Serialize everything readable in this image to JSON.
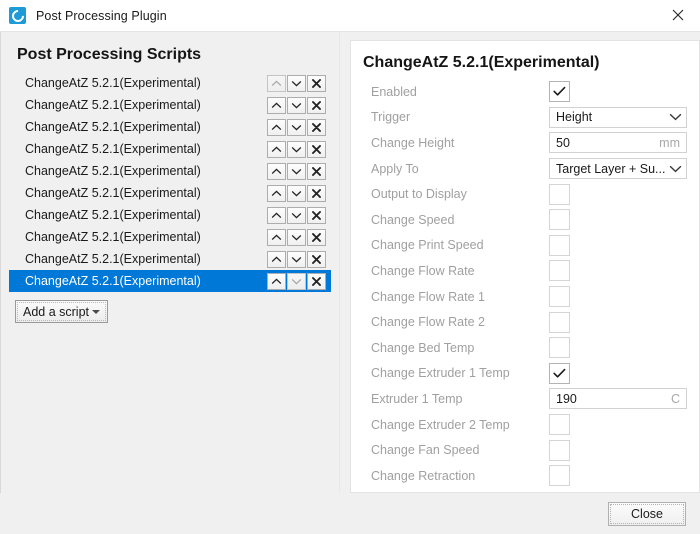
{
  "window": {
    "title": "Post Processing Plugin",
    "app_icon": "cura-logo-icon",
    "close_icon": "close-icon"
  },
  "left_panel": {
    "heading": "Post Processing Scripts",
    "scripts": [
      {
        "label": "ChangeAtZ 5.2.1(Experimental)",
        "selected": false,
        "up_enabled": false,
        "down_enabled": true
      },
      {
        "label": "ChangeAtZ 5.2.1(Experimental)",
        "selected": false,
        "up_enabled": true,
        "down_enabled": true
      },
      {
        "label": "ChangeAtZ 5.2.1(Experimental)",
        "selected": false,
        "up_enabled": true,
        "down_enabled": true
      },
      {
        "label": "ChangeAtZ 5.2.1(Experimental)",
        "selected": false,
        "up_enabled": true,
        "down_enabled": true
      },
      {
        "label": "ChangeAtZ 5.2.1(Experimental)",
        "selected": false,
        "up_enabled": true,
        "down_enabled": true
      },
      {
        "label": "ChangeAtZ 5.2.1(Experimental)",
        "selected": false,
        "up_enabled": true,
        "down_enabled": true
      },
      {
        "label": "ChangeAtZ 5.2.1(Experimental)",
        "selected": false,
        "up_enabled": true,
        "down_enabled": true
      },
      {
        "label": "ChangeAtZ 5.2.1(Experimental)",
        "selected": false,
        "up_enabled": true,
        "down_enabled": true
      },
      {
        "label": "ChangeAtZ 5.2.1(Experimental)",
        "selected": false,
        "up_enabled": true,
        "down_enabled": true
      },
      {
        "label": "ChangeAtZ 5.2.1(Experimental)",
        "selected": true,
        "up_enabled": true,
        "down_enabled": false
      }
    ],
    "row_icons": {
      "move_up": "chevron-up-icon",
      "move_down": "chevron-down-icon",
      "remove": "close-x-icon"
    },
    "add_script_button": "Add a script"
  },
  "right_panel": {
    "heading": "ChangeAtZ 5.2.1(Experimental)",
    "settings": [
      {
        "label": "Enabled",
        "type": "checkbox",
        "checked": true
      },
      {
        "label": "Trigger",
        "type": "combo",
        "value": "Height"
      },
      {
        "label": "Change Height",
        "type": "text",
        "value": "50",
        "unit": "mm"
      },
      {
        "label": "Apply To",
        "type": "combo",
        "value": "Target Layer + Su..."
      },
      {
        "label": "Output to Display",
        "type": "checkbox",
        "checked": false
      },
      {
        "label": "Change Speed",
        "type": "checkbox",
        "checked": false
      },
      {
        "label": "Change Print Speed",
        "type": "checkbox",
        "checked": false
      },
      {
        "label": "Change Flow Rate",
        "type": "checkbox",
        "checked": false
      },
      {
        "label": "Change Flow Rate 1",
        "type": "checkbox",
        "checked": false
      },
      {
        "label": "Change Flow Rate 2",
        "type": "checkbox",
        "checked": false
      },
      {
        "label": "Change Bed Temp",
        "type": "checkbox",
        "checked": false
      },
      {
        "label": "Change Extruder 1 Temp",
        "type": "checkbox",
        "checked": true
      },
      {
        "label": "Extruder 1 Temp",
        "type": "text",
        "value": "190",
        "unit": "C"
      },
      {
        "label": "Change Extruder 2 Temp",
        "type": "checkbox",
        "checked": false
      },
      {
        "label": "Change Fan Speed",
        "type": "checkbox",
        "checked": false
      },
      {
        "label": "Change Retraction",
        "type": "checkbox",
        "checked": false
      }
    ]
  },
  "footer": {
    "close_button": "Close"
  },
  "colors": {
    "selection_blue": "#0078d7",
    "window_background": "#f0f0f0",
    "panel_white": "#ffffff",
    "label_gray": "#a0a0a0",
    "logo_blue": "#1e9bd7"
  }
}
